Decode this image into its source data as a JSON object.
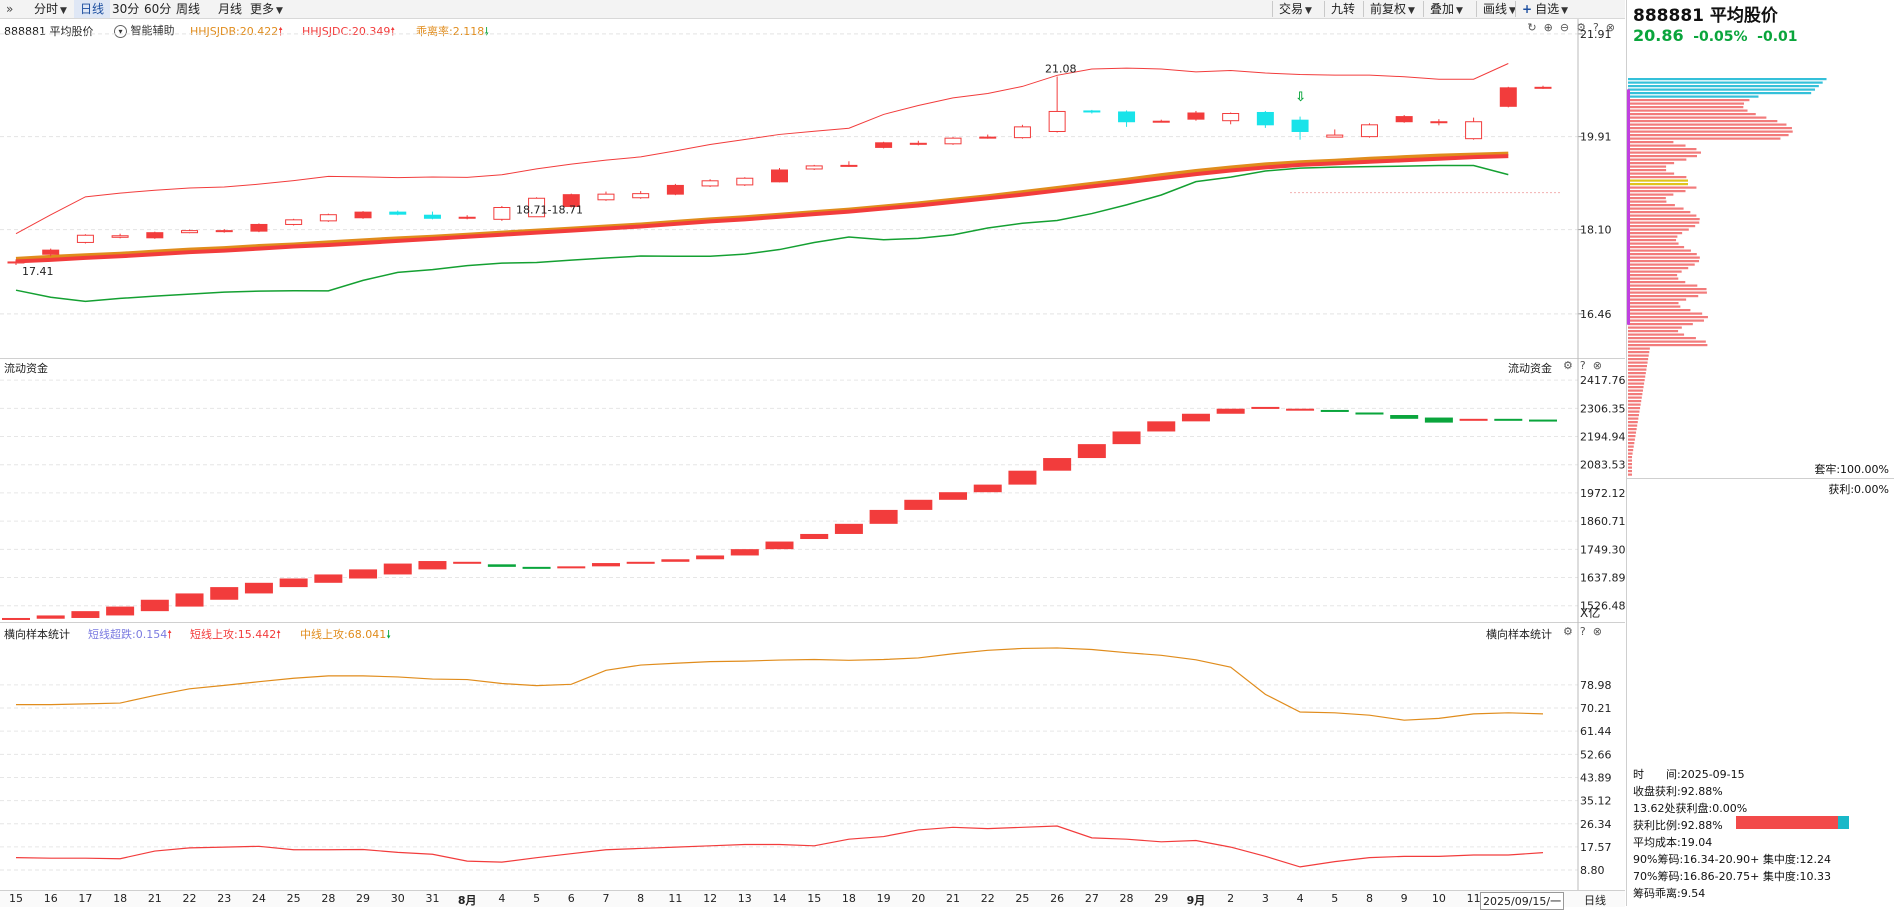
{
  "toolbar": {
    "nav_icon": "double-chevron-icon",
    "left": [
      {
        "name": "period-fenshi",
        "label": "分时",
        "dropdown": true
      },
      {
        "name": "period-daily",
        "label": "日线",
        "active": true
      },
      {
        "name": "period-30min",
        "label": "30分"
      },
      {
        "name": "period-60min",
        "label": "60分"
      },
      {
        "name": "period-weekly",
        "label": "周线"
      },
      {
        "name": "period-monthly",
        "label": "月线"
      },
      {
        "name": "period-more",
        "label": "更多",
        "dropdown": true
      }
    ],
    "right": [
      {
        "name": "trade-menu",
        "label": "交易",
        "dropdown": true
      },
      {
        "name": "jiuzhuan-button",
        "label": "九转"
      },
      {
        "name": "adjust-menu",
        "label": "前复权",
        "dropdown": true
      },
      {
        "name": "overlay-menu",
        "label": "叠加",
        "dropdown": true
      },
      {
        "name": "draw-button",
        "label": "画线",
        "dropdown": true
      },
      {
        "name": "watchlist-button",
        "label": "自选",
        "plus": true,
        "dropdown": true
      }
    ]
  },
  "quote": {
    "code": "888881",
    "name": "平均股价",
    "price": "20.86",
    "pct": "-0.05%",
    "change": "-0.01"
  },
  "main_panel": {
    "title": "888881 平均股价",
    "assist": "智能辅助",
    "ind1": "HHJSJDB:20.422",
    "ind2": "HHJSJDC:20.349",
    "ind3": "乖离率:2.118",
    "price_ticks": [
      "21.91",
      "19.91",
      "18.10",
      "16.46"
    ],
    "annotations": {
      "low": "17.41",
      "high": "21.08",
      "mid": "18.71-18.71"
    }
  },
  "flow_panel": {
    "title": "流动资金",
    "title_right": "流动资金",
    "ticks": [
      "2417.76",
      "2306.35",
      "2194.94",
      "2083.53",
      "1972.12",
      "1860.71",
      "1749.30",
      "1637.89",
      "1526.48"
    ],
    "unit": "X亿"
  },
  "stat_panel": {
    "title": "横向样本统计",
    "title_right": "横向样本统计",
    "ind1": "短线超跌:0.154",
    "ind2": "短线上攻:15.442",
    "ind3": "中线上攻:68.041",
    "ticks": [
      "78.98",
      "70.21",
      "61.44",
      "52.66",
      "43.89",
      "35.12",
      "26.34",
      "17.57",
      "8.80"
    ]
  },
  "date_axis": {
    "labels": [
      "15",
      "16",
      "17",
      "18",
      "21",
      "22",
      "23",
      "24",
      "25",
      "28",
      "29",
      "30",
      "31",
      "8月",
      "4",
      "5",
      "6",
      "7",
      "8",
      "11",
      "12",
      "13",
      "14",
      "15",
      "18",
      "19",
      "20",
      "21",
      "22",
      "25",
      "26",
      "27",
      "28",
      "29",
      "9月",
      "2",
      "3",
      "4",
      "5",
      "8",
      "9",
      "10",
      "11",
      "12"
    ],
    "current": "2025/09/15/一",
    "period": "日线"
  },
  "chip_panel": {
    "locked": "套牢:100.00%",
    "profit": "获利:0.00%",
    "stats": [
      "时　　间:2025-09-15",
      "收盘获利:92.88%",
      "13.62处获利盘:0.00%",
      "获利比例:92.88%",
      "平均成本:19.04",
      "90%筹码:16.34-20.90+ 集中度:12.24",
      "70%筹码:16.86-20.75+ 集中度:10.33",
      "筹码乖离:9.54"
    ]
  },
  "colors": {
    "up": "#f23c3c",
    "down": "#0aa53c",
    "cyan": "#19e3e9",
    "orange": "#e08c1c",
    "green_line": "#14a032",
    "accent_blue": "#1d4fa0"
  },
  "chart_data": [
    {
      "type": "candlestick",
      "title": "888881 平均股价",
      "categories": [
        "15",
        "16",
        "17",
        "18",
        "21",
        "22",
        "23",
        "24",
        "25",
        "28",
        "29",
        "30",
        "31",
        "8/1",
        "4",
        "5",
        "6",
        "7",
        "8",
        "11",
        "12",
        "13",
        "14",
        "15",
        "18",
        "19",
        "20",
        "21",
        "22",
        "25",
        "26",
        "27",
        "28",
        "29",
        "9/1",
        "2",
        "3",
        "4",
        "5",
        "8",
        "9",
        "10",
        "11",
        "12",
        "15"
      ],
      "open": [
        17.45,
        17.62,
        17.85,
        17.95,
        17.94,
        18.04,
        18.06,
        18.07,
        18.2,
        18.27,
        18.33,
        18.44,
        18.38,
        18.33,
        18.3,
        18.35,
        18.55,
        18.68,
        18.72,
        18.79,
        18.95,
        18.97,
        19.03,
        19.28,
        19.35,
        19.7,
        19.76,
        19.77,
        19.9,
        19.89,
        20.01,
        20.41,
        20.39,
        20.21,
        20.25,
        20.22,
        20.38,
        20.23,
        19.9,
        19.91,
        20.2,
        20.2,
        19.87,
        20.5,
        20.86
      ],
      "close": [
        17.47,
        17.7,
        17.99,
        17.98,
        18.04,
        18.08,
        18.08,
        18.2,
        18.29,
        18.39,
        18.44,
        18.4,
        18.32,
        18.34,
        18.53,
        18.71,
        18.78,
        18.79,
        18.8,
        18.96,
        19.05,
        19.1,
        19.26,
        19.34,
        19.35,
        19.79,
        19.78,
        19.88,
        19.9,
        20.1,
        20.4,
        20.39,
        20.2,
        20.21,
        20.37,
        20.36,
        20.14,
        20.01,
        19.94,
        20.14,
        20.3,
        20.2,
        20.2,
        20.86,
        20.87
      ],
      "high": [
        17.52,
        17.73,
        18.01,
        18.02,
        18.06,
        18.1,
        18.11,
        18.22,
        18.31,
        18.41,
        18.46,
        18.47,
        18.45,
        18.38,
        18.56,
        18.73,
        18.8,
        18.84,
        18.85,
        18.99,
        19.08,
        19.12,
        19.3,
        19.36,
        19.43,
        19.81,
        19.83,
        19.9,
        19.95,
        20.14,
        21.08,
        20.43,
        20.42,
        20.24,
        20.41,
        20.38,
        20.41,
        20.3,
        20.05,
        20.17,
        20.33,
        20.25,
        20.28,
        20.88,
        20.9
      ],
      "low": [
        17.41,
        17.58,
        17.83,
        17.93,
        17.92,
        18.03,
        18.04,
        18.05,
        18.18,
        18.25,
        18.31,
        18.38,
        18.3,
        18.3,
        18.27,
        18.71,
        18.53,
        18.66,
        18.7,
        18.77,
        18.93,
        18.95,
        19.02,
        19.26,
        19.32,
        19.68,
        19.74,
        19.75,
        19.87,
        19.87,
        19.99,
        20.36,
        20.1,
        20.19,
        20.22,
        20.15,
        20.08,
        19.85,
        19.9,
        19.89,
        20.18,
        20.13,
        19.85,
        20.48,
        20.84
      ],
      "series": [
        {
          "name": "HHJSJDB",
          "values": [
            17.53,
            17.57,
            17.6,
            17.63,
            17.67,
            17.71,
            17.74,
            17.78,
            17.81,
            17.85,
            17.89,
            17.93,
            17.96,
            18.0,
            18.04,
            18.08,
            18.12,
            18.16,
            18.2,
            18.25,
            18.3,
            18.34,
            18.39,
            18.44,
            18.49,
            18.55,
            18.61,
            18.68,
            18.75,
            18.83,
            18.91,
            18.99,
            19.07,
            19.16,
            19.24,
            19.31,
            19.37,
            19.41,
            19.44,
            19.48,
            19.51,
            19.54,
            19.56,
            19.58,
            20.42
          ]
        },
        {
          "name": "HHJSJDC",
          "values": [
            17.48,
            17.51,
            17.55,
            17.58,
            17.62,
            17.66,
            17.69,
            17.73,
            17.77,
            17.8,
            17.84,
            17.88,
            17.92,
            17.96,
            18.0,
            18.04,
            18.08,
            18.12,
            18.16,
            18.21,
            18.26,
            18.3,
            18.35,
            18.4,
            18.45,
            18.51,
            18.57,
            18.64,
            18.71,
            18.78,
            18.86,
            18.94,
            19.02,
            19.1,
            19.18,
            19.25,
            19.31,
            19.36,
            19.39,
            19.42,
            19.45,
            19.48,
            19.51,
            19.53,
            20.35
          ]
        }
      ],
      "ylim": [
        15.6,
        22.2
      ]
    },
    {
      "type": "candlestick",
      "title": "流动资金",
      "ylabel": "X亿",
      "open": [
        1475,
        1475,
        1478,
        1488,
        1505,
        1523,
        1550,
        1575,
        1600,
        1617,
        1634,
        1650,
        1670,
        1693,
        1690,
        1680,
        1677,
        1682,
        1695,
        1700,
        1710,
        1725,
        1750,
        1790,
        1810,
        1850,
        1905,
        1945,
        1975,
        2005,
        2060,
        2110,
        2165,
        2215,
        2255,
        2285,
        2305,
        2305,
        2300,
        2290,
        2280,
        2270,
        2262,
        2265,
        2262
      ],
      "close": [
        1478,
        1488,
        1505,
        1523,
        1550,
        1575,
        1600,
        1617,
        1634,
        1650,
        1670,
        1693,
        1703,
        1700,
        1680,
        1677,
        1682,
        1695,
        1700,
        1710,
        1725,
        1750,
        1780,
        1810,
        1850,
        1905,
        1945,
        1975,
        2005,
        2060,
        2110,
        2165,
        2215,
        2255,
        2285,
        2305,
        2312,
        2305,
        2295,
        2282,
        2265,
        2250,
        2265,
        2262,
        2255
      ],
      "ylim": [
        1470,
        2450
      ]
    },
    {
      "type": "line",
      "title": "横向样本统计",
      "series": [
        {
          "name": "中线上攻",
          "values": [
            71.5,
            71.5,
            71.8,
            72.1,
            75.0,
            77.5,
            78.8,
            80.2,
            81.5,
            82.4,
            82.4,
            82.0,
            81.2,
            81.0,
            79.5,
            78.7,
            79.2,
            84.5,
            86.5,
            87.2,
            87.8,
            88.0,
            88.4,
            88.6,
            88.3,
            88.6,
            89.2,
            90.8,
            92.1,
            92.8,
            93.0,
            92.4,
            91.2,
            90.2,
            88.5,
            85.7,
            75.4,
            68.7,
            68.4,
            67.5,
            65.6,
            66.3,
            68.0,
            68.4,
            68.0
          ]
        },
        {
          "name": "短线上攻",
          "values": [
            13.5,
            13.3,
            13.3,
            13.1,
            16.0,
            17.2,
            17.5,
            17.8,
            16.5,
            16.5,
            16.6,
            15.5,
            14.8,
            12.2,
            11.8,
            13.5,
            15.0,
            16.5,
            17.0,
            17.5,
            18.0,
            18.5,
            18.5,
            18.0,
            20.5,
            21.5,
            24.0,
            25.0,
            24.5,
            25.0,
            25.5,
            21.0,
            20.5,
            19.5,
            20.0,
            17.5,
            14.0,
            10.0,
            12.0,
            13.5,
            14.0,
            14.0,
            14.5,
            14.5,
            15.4
          ]
        },
        {
          "name": "短线超跌",
          "values": [
            0.2,
            0.2,
            0.2,
            0.2,
            0.2,
            0.2,
            0.2,
            0.2,
            0.2,
            0.2,
            0.2,
            0.2,
            0.2,
            0.2,
            0.2,
            0.2,
            0.2,
            0.2,
            0.2,
            0.2,
            0.2,
            0.2,
            0.2,
            0.2,
            0.2,
            0.2,
            0.2,
            0.2,
            0.2,
            0.2,
            0.2,
            0.2,
            0.2,
            0.2,
            0.2,
            0.2,
            0.2,
            0.2,
            0.2,
            0.2,
            0.2,
            0.2,
            0.2,
            0.2,
            0.15
          ]
        }
      ],
      "ylim": [
        2,
        96
      ]
    }
  ]
}
